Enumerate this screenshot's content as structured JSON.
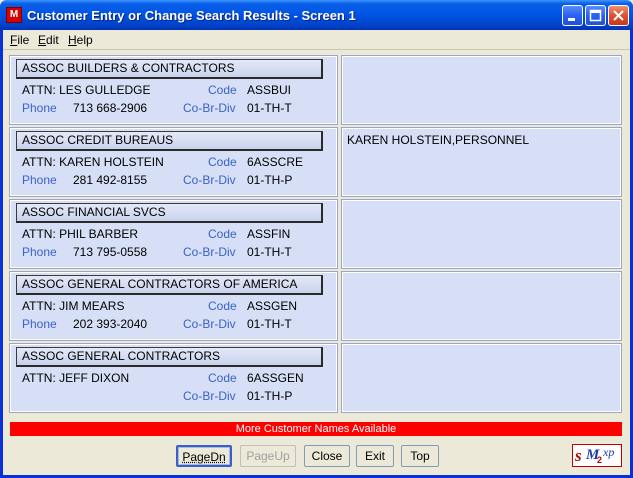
{
  "window": {
    "title": "Customer Entry or Change Search Results - Screen 1",
    "app_icon": "sm-app-icon",
    "app_icon_text": "M"
  },
  "menu": [
    {
      "label": "File",
      "accel": "F",
      "rest": "ile"
    },
    {
      "label": "Edit",
      "accel": "E",
      "rest": "dit"
    },
    {
      "label": "Help",
      "accel": "H",
      "rest": "elp"
    }
  ],
  "labels": {
    "code": "Code",
    "phone": "Phone",
    "div": "Co-Br-Div"
  },
  "customers": [
    {
      "name": "ASSOC BUILDERS & CONTRACTORS",
      "attn": "ATTN: LES GULLEDGE",
      "code": "ASSBUI",
      "phone": "713 668-2906",
      "div": "01-TH-T",
      "note": ""
    },
    {
      "name": "ASSOC CREDIT BUREAUS",
      "attn": "ATTN: KAREN HOLSTEIN",
      "code": "6ASSCRE",
      "phone": "281 492-8155",
      "div": "01-TH-P",
      "note": "KAREN HOLSTEIN,PERSONNEL"
    },
    {
      "name": "ASSOC FINANCIAL SVCS",
      "attn": "ATTN: PHIL BARBER",
      "code": "ASSFIN",
      "phone": "713 795-0558",
      "div": "01-TH-T",
      "note": ""
    },
    {
      "name": "ASSOC GENERAL CONTRACTORS OF AMERICA",
      "attn": "ATTN: JIM MEARS",
      "code": "ASSGEN",
      "phone": "202 393-2040",
      "div": "01-TH-T",
      "note": ""
    },
    {
      "name": "ASSOC GENERAL CONTRACTORS",
      "attn": "ATTN: JEFF DIXON",
      "code": "6ASSGEN",
      "phone": "",
      "div": "01-TH-P",
      "note": ""
    }
  ],
  "status": "More Customer Names Available",
  "buttons": {
    "pagedn": "PageDn",
    "pageup": "PageUp",
    "close": "Close",
    "exit": "Exit",
    "top": "Top"
  },
  "logo": {
    "s": "s",
    "m": "M",
    "two": "2",
    "xp": "xp"
  },
  "colors": {
    "status_bg": "#ff0000",
    "label_blue": "#3a62c8",
    "card_bg": "#d6dff5",
    "titlebar": "#0055e5"
  }
}
